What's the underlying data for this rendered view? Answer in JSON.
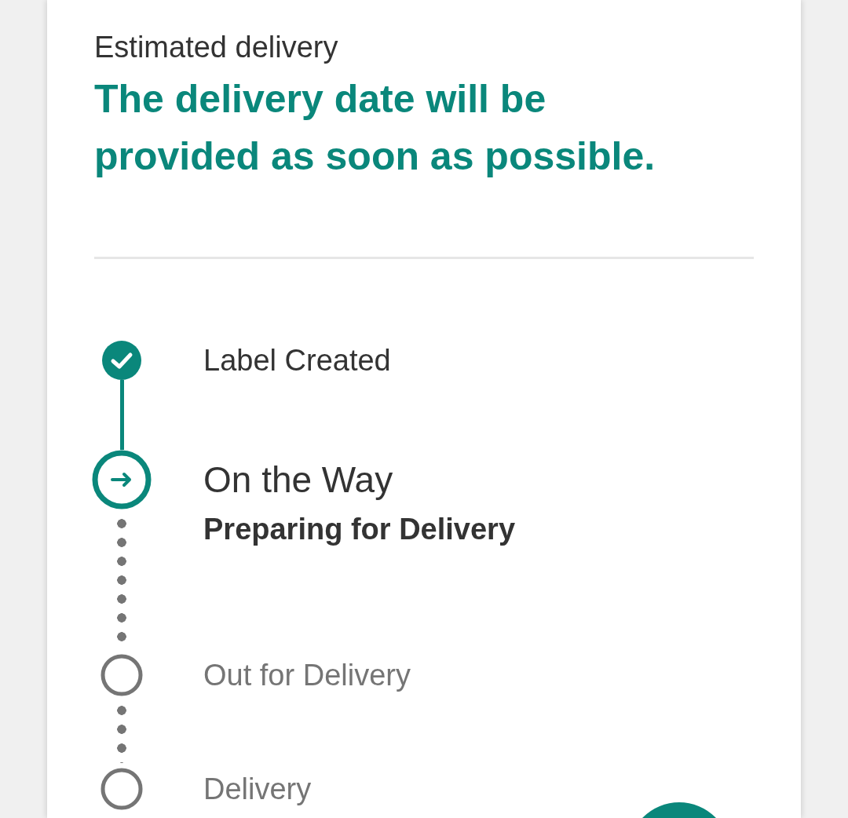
{
  "estimate": {
    "label": "Estimated delivery",
    "message": "The delivery date will be provided as soon as possible."
  },
  "steps": [
    {
      "kind": "done",
      "title": "Label Created"
    },
    {
      "kind": "current",
      "title": "On the Way",
      "subtitle": "Preparing for Delivery"
    },
    {
      "kind": "pending",
      "title": "Out for Delivery"
    },
    {
      "kind": "pending",
      "title": "Delivery"
    }
  ]
}
